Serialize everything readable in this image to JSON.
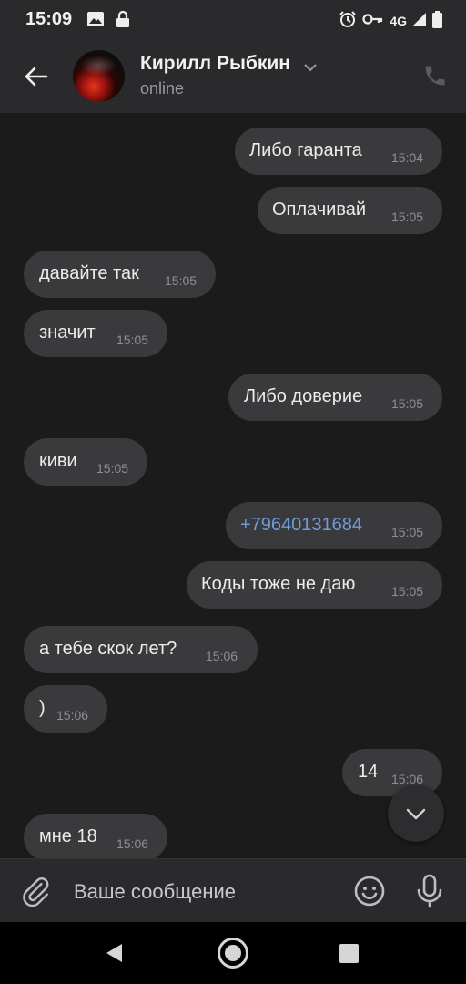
{
  "status_bar": {
    "time": "15:09",
    "network": "4G",
    "icons": [
      "image-icon",
      "lock-icon",
      "alarm-icon",
      "key-icon",
      "signal-icon",
      "battery-icon"
    ]
  },
  "header": {
    "contact_name": "Кирилл Рыбкин",
    "status": "online",
    "icons": [
      "back-arrow-icon",
      "chevron-down-icon",
      "phone-icon"
    ]
  },
  "messages": [
    {
      "side": "out",
      "text": "Либо гаранта",
      "time": "15:04"
    },
    {
      "side": "out",
      "text": "Оплачивай",
      "time": "15:05"
    },
    {
      "side": "in",
      "text": "давайте так",
      "time": "15:05"
    },
    {
      "side": "in",
      "text": "значит",
      "time": "15:05"
    },
    {
      "side": "out",
      "text": "Либо доверие",
      "time": "15:05"
    },
    {
      "side": "in",
      "text": "киви",
      "time": "15:05"
    },
    {
      "side": "out",
      "text": "+79640131684",
      "time": "15:05",
      "link": true
    },
    {
      "side": "out",
      "text": "Коды тоже не даю",
      "time": "15:05"
    },
    {
      "side": "in",
      "text": "а тебе скок лет?",
      "time": "15:06"
    },
    {
      "side": "in",
      "text": ")",
      "time": "15:06"
    },
    {
      "side": "out",
      "text": "14",
      "time": "15:06"
    },
    {
      "side": "in",
      "text": "мне 18",
      "time": "15:06"
    }
  ],
  "composer": {
    "placeholder": "Ваше сообщение",
    "icons": [
      "paperclip-icon",
      "emoji-icon",
      "microphone-icon"
    ]
  },
  "colors": {
    "background": "#1b1b1c",
    "bar": "#2a2a2c",
    "bubble": "#3a3a3c",
    "link": "#6f9bd8",
    "muted": "#8f8f91"
  }
}
